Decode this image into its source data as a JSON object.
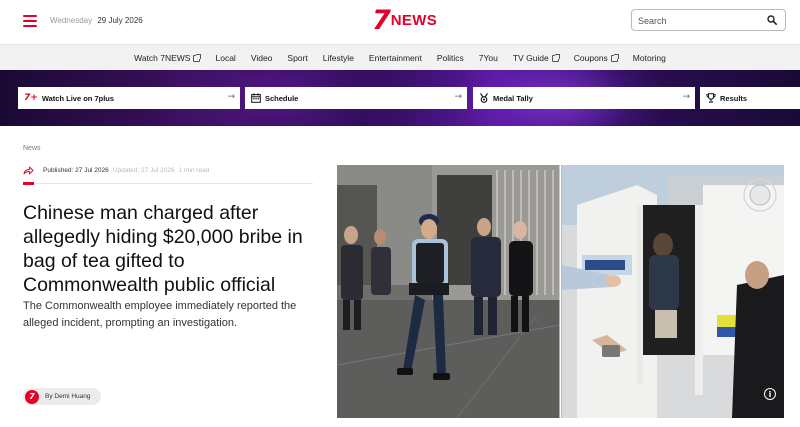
{
  "header": {
    "date_weekday": "Wednesday",
    "date_value": "29 July 2026",
    "logo_mark": "7",
    "logo_text": "NEWS",
    "search_placeholder": "Search",
    "menu_icon": "hamburger-icon",
    "search_icon": "magnifier-icon",
    "brand_color": "#e4002b"
  },
  "nav": {
    "items": [
      {
        "label": "Watch 7NEWS",
        "external": true
      },
      {
        "label": "Local",
        "external": false
      },
      {
        "label": "Video",
        "external": false
      },
      {
        "label": "Sport",
        "external": false
      },
      {
        "label": "Lifestyle",
        "external": false
      },
      {
        "label": "Entertainment",
        "external": false
      },
      {
        "label": "Politics",
        "external": false
      },
      {
        "label": "7You",
        "external": false
      },
      {
        "label": "TV Guide",
        "external": true
      },
      {
        "label": "Coupons",
        "external": true
      },
      {
        "label": "Motoring",
        "external": false
      }
    ]
  },
  "promos": {
    "watch_live": {
      "mark": "7+",
      "label": "Watch Live on 7plus",
      "arrow": "→"
    },
    "schedule": {
      "label": "Schedule",
      "icon": "calendar-icon",
      "arrow": "→"
    },
    "medal_tally": {
      "label": "Medal Tally",
      "icon": "medal-icon",
      "arrow": "→"
    },
    "results": {
      "label": "Results",
      "icon": "trophy-icon"
    }
  },
  "article": {
    "kicker": "News",
    "published": "Published: 27 Jul 2026",
    "updated": "Updated: 27 Jul 2026",
    "read_time": "1 min read",
    "headline": "Chinese man charged after allegedly hiding $20,000 bribe in bag of tea gifted to Commonwealth public official",
    "standfirst": "The Commonwealth employee immediately reported the alleged incident, prompting an investigation.",
    "byline": "By Demi Huang",
    "avatar_mark": "7",
    "info_glyph": "i"
  }
}
